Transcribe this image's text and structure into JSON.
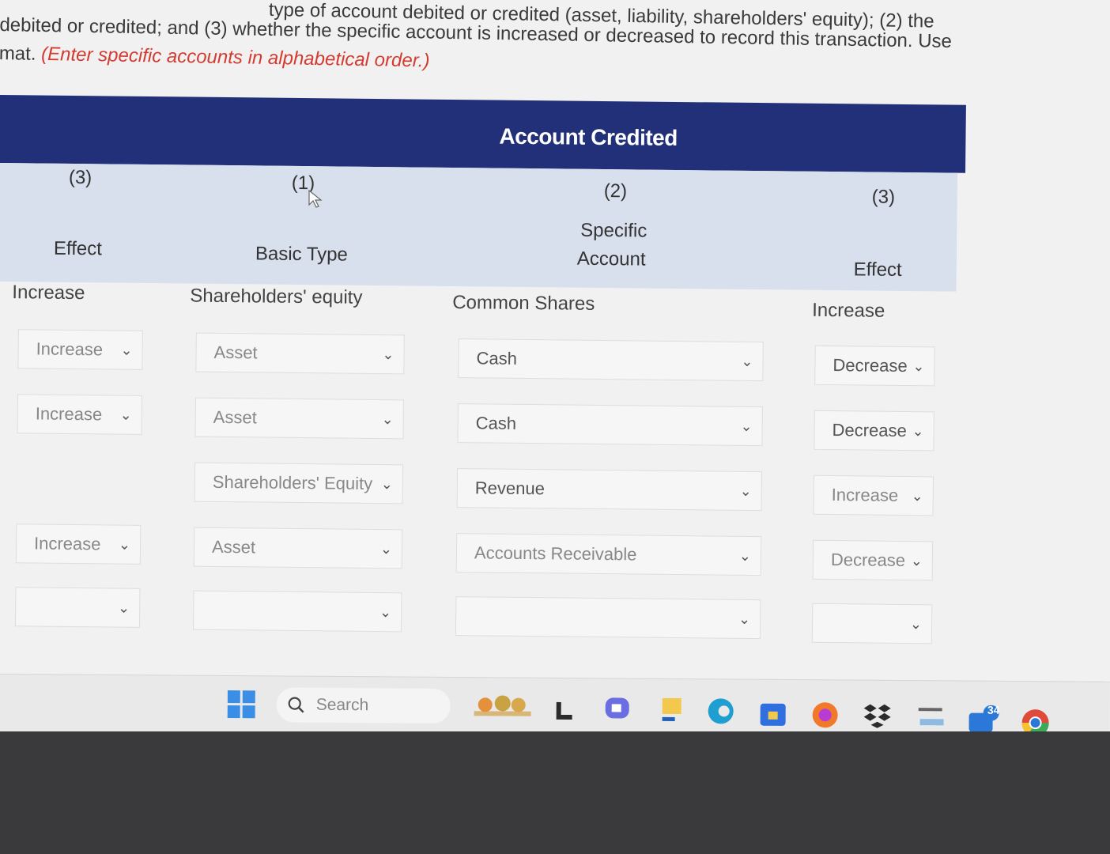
{
  "instructions": {
    "line1": "type of account debited or credited (asset, liability, shareholders' equity); (2) the",
    "line2": "debited or credited; and (3) whether the specific account is increased or decreased to record this transaction. Use",
    "line3_prefix": "mat.",
    "line3_red": "(Enter specific accounts in alphabetical order.)"
  },
  "table": {
    "banner_title": "Account Credited",
    "headers": {
      "left_num": "(3)",
      "left_label": "Effect",
      "col1_num": "(1)",
      "col1_label": "Basic Type",
      "col2_num": "(2)",
      "col2_label_line1": "Specific",
      "col2_label_line2": "Account",
      "col3_num": "(3)",
      "col3_label": "Effect"
    },
    "static_row": {
      "left_effect": "Increase",
      "basic_type": "Shareholders' equity",
      "specific_account": "Common Shares",
      "effect": "Increase"
    },
    "rows": [
      {
        "left_effect": "Increase",
        "basic_type": "Asset",
        "specific_account": "Cash",
        "effect": "Decrease"
      },
      {
        "left_effect": "Increase",
        "basic_type": "Asset",
        "specific_account": "Cash",
        "effect": "Decrease"
      },
      {
        "left_effect": "",
        "basic_type": "Shareholders' Equity",
        "specific_account": "Revenue",
        "effect": "Increase"
      },
      {
        "left_effect": "Increase",
        "basic_type": "Asset",
        "specific_account": "Accounts Receivable",
        "effect": "Decrease"
      },
      {
        "left_effect": "",
        "basic_type": "",
        "specific_account": "",
        "effect": ""
      }
    ]
  },
  "taskbar": {
    "search_placeholder": "Search",
    "badge_count": "34",
    "icons": [
      "windows-start-icon",
      "search-icon",
      "widgets-icon",
      "file-icon",
      "teams-icon",
      "folder-icon",
      "edge-icon",
      "store-icon",
      "firefox-icon",
      "dropbox-icon",
      "amazon-icon",
      "chat-icon",
      "chrome-icon"
    ]
  }
}
